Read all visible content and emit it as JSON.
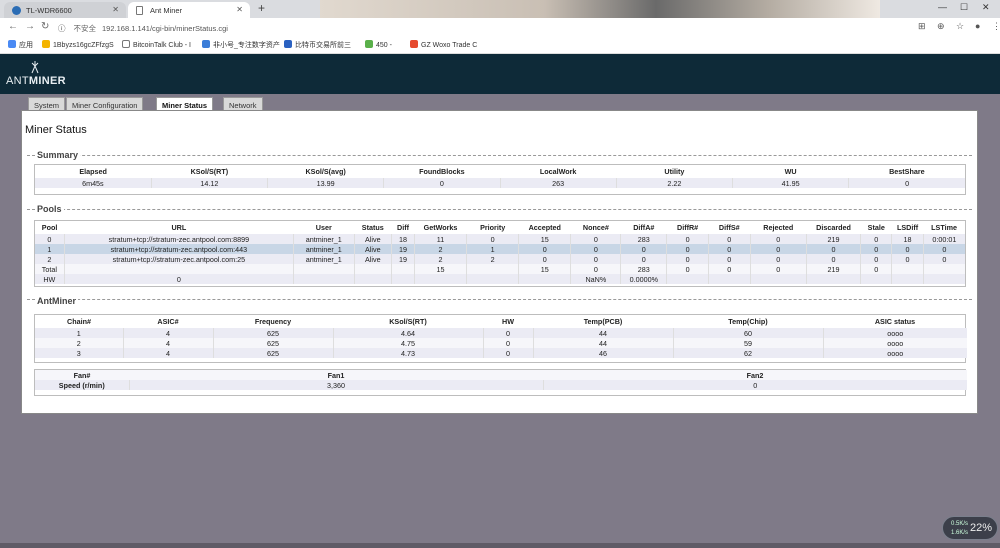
{
  "browser": {
    "tabs": [
      {
        "label": "TL-WDR6600"
      },
      {
        "label": "Ant Miner"
      }
    ],
    "insecure_label": "不安全",
    "url": "192.168.1.141/cgi-bin/minerStatus.cgi",
    "bookmarks": [
      "应用",
      "1Bbyzs16gcZFfzgS",
      "BitcoinTalk Club - I",
      "非小号_专注数字资产",
      "比特币交易所前三",
      "450 - ",
      "GZ Woxo Trade C"
    ]
  },
  "header": {
    "logo_ant": "ANT",
    "logo_miner": "MINER"
  },
  "nav": {
    "tabs": [
      "System",
      "Miner Configuration",
      "Miner Status",
      "Network"
    ]
  },
  "page_title": "Miner Status",
  "summary": {
    "legend": "Summary",
    "headers": [
      "Elapsed",
      "KSol/S(RT)",
      "KSol/S(avg)",
      "FoundBlocks",
      "LocalWork",
      "Utility",
      "WU",
      "BestShare"
    ],
    "row": [
      "6m45s",
      "14.12",
      "13.99",
      "0",
      "263",
      "2.22",
      "41.95",
      "0"
    ]
  },
  "pools": {
    "legend": "Pools",
    "headers": [
      "Pool",
      "URL",
      "User",
      "Status",
      "Diff",
      "GetWorks",
      "Priority",
      "Accepted",
      "Nonce#",
      "DiffA#",
      "DiffR#",
      "DiffS#",
      "Rejected",
      "Discarded",
      "Stale",
      "LSDiff",
      "LSTime"
    ],
    "rows": [
      [
        "0",
        "stratum+tcp://stratum-zec.antpool.com:8899",
        "antminer_1",
        "Alive",
        "18",
        "11",
        "0",
        "15",
        "0",
        "283",
        "0",
        "0",
        "0",
        "219",
        "0",
        "18",
        "0:00:01"
      ],
      [
        "1",
        "stratum+tcp://stratum-zec.antpool.com:443",
        "antminer_1",
        "Alive",
        "19",
        "2",
        "1",
        "0",
        "0",
        "0",
        "0",
        "0",
        "0",
        "0",
        "0",
        "0",
        "0"
      ],
      [
        "2",
        "stratum+tcp://stratum-zec.antpool.com:25",
        "antminer_1",
        "Alive",
        "19",
        "2",
        "2",
        "0",
        "0",
        "0",
        "0",
        "0",
        "0",
        "0",
        "0",
        "0",
        "0"
      ],
      [
        "Total",
        "",
        "",
        "",
        "",
        "15",
        "",
        "15",
        "0",
        "283",
        "0",
        "0",
        "0",
        "219",
        "0",
        "",
        ""
      ],
      [
        "HW",
        "0",
        "",
        "",
        "",
        "",
        "",
        "",
        "NaN%",
        "0.0000%",
        "",
        "",
        "",
        "",
        "",
        "",
        ""
      ]
    ]
  },
  "antminer": {
    "legend": "AntMiner",
    "headers": [
      "Chain#",
      "ASIC#",
      "Frequency",
      "KSol/S(RT)",
      "HW",
      "Temp(PCB)",
      "Temp(Chip)",
      "ASIC status"
    ],
    "rows": [
      [
        "1",
        "4",
        "625",
        "4.64",
        "0",
        "44",
        "60",
        "oooo"
      ],
      [
        "2",
        "4",
        "625",
        "4.75",
        "0",
        "44",
        "59",
        "oooo"
      ],
      [
        "3",
        "4",
        "625",
        "4.73",
        "0",
        "46",
        "62",
        "oooo"
      ]
    ]
  },
  "fans": {
    "headers": [
      "Fan#",
      "Fan1",
      "Fan2"
    ],
    "row_label": "Speed (r/min)",
    "values": [
      "3,360",
      "0"
    ]
  },
  "widget": {
    "up": "0.5K/s",
    "down": "1.6K/s",
    "percent": "22%"
  }
}
